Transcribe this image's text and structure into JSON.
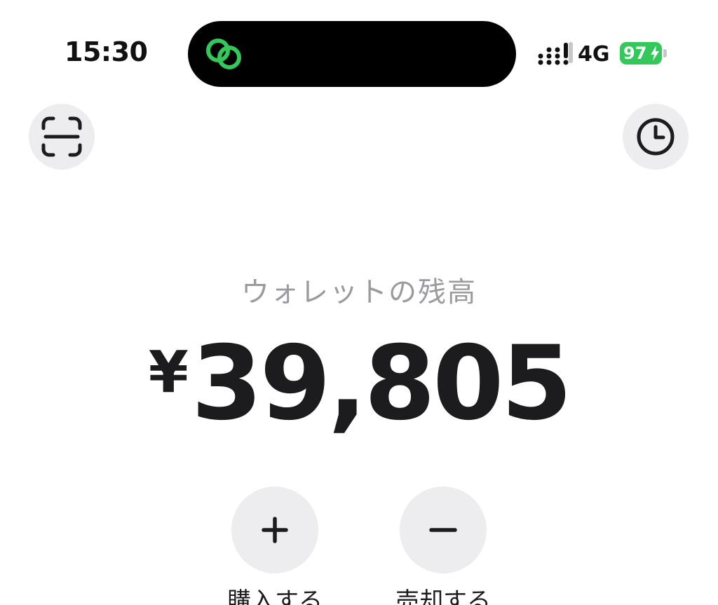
{
  "status_bar": {
    "time": "15:30",
    "network": "4G",
    "battery": "97",
    "battery_color": "#34c759",
    "island_icon": "link-rings-icon"
  },
  "toolbar": {
    "left_icon": "scan-icon",
    "right_icon": "clock-icon"
  },
  "wallet": {
    "label": "ウォレットの残高",
    "currency": "¥",
    "amount": "39,805"
  },
  "actions": [
    {
      "icon": "plus-icon",
      "label": "購入する"
    },
    {
      "icon": "minus-icon",
      "label": "売却する"
    }
  ],
  "colors": {
    "accent_green": "#34c759",
    "button_bg": "#ededf0",
    "muted_text": "#9a9aa0",
    "primary_text": "#1c1c1e"
  }
}
